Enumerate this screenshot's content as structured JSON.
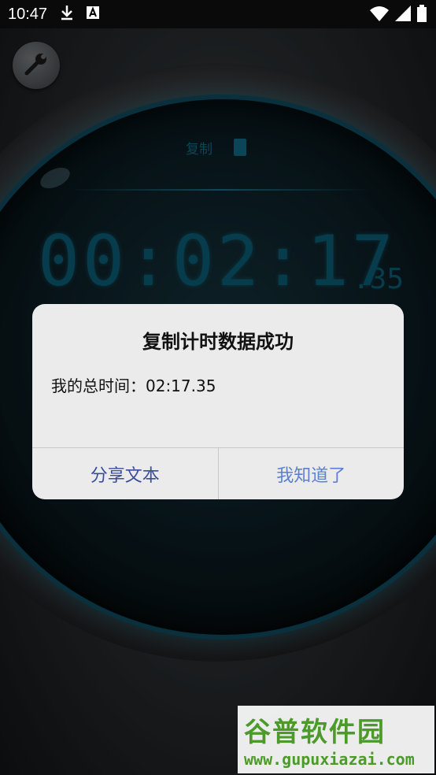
{
  "status_bar": {
    "time": "10:47",
    "icons": [
      "download-icon",
      "a-icon"
    ],
    "right_icons": [
      "wifi-icon",
      "signal-icon",
      "battery-icon"
    ]
  },
  "app": {
    "copy_label": "复制",
    "timer_main": "00:02:17",
    "timer_sub": ".35"
  },
  "dialog": {
    "title": "复制计时数据成功",
    "message": "我的总时间：02:17.35",
    "share_button": "分享文本",
    "ok_button": "我知道了"
  },
  "watermark": {
    "title": "谷普软件园",
    "url": "www.gupuxiazai.com"
  },
  "colors": {
    "lcd": "#0c5d76",
    "dialog_bg": "#ebebeb",
    "share": "#3a4d9c",
    "ok": "#5c7fd4",
    "watermark": "#4c9a2a"
  }
}
